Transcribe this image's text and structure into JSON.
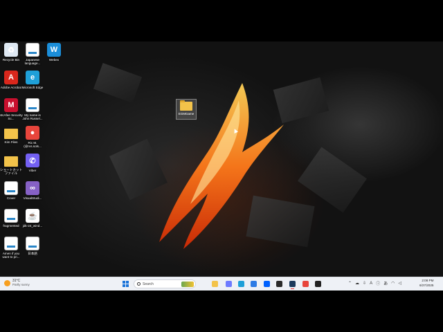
{
  "desktop": {
    "icons": [
      {
        "label": "Recycle Bin",
        "icon": "recycle-bin-icon",
        "color": "#dfe9f3",
        "glyph": "♻"
      },
      {
        "label": "Japanese language...",
        "icon": "document-icon",
        "color": "#ffffff",
        "glyph": ""
      },
      {
        "label": "Webex",
        "icon": "webex-icon",
        "color": "#1b8ed9",
        "glyph": "W"
      },
      {
        "label": "Adobe Acrobat",
        "icon": "acrobat-icon",
        "color": "#d9271c",
        "glyph": "A"
      },
      {
        "label": "Microsoft Edge",
        "icon": "edge-icon",
        "color": "#1fa0d8",
        "glyph": "e"
      },
      {
        "label": "McAfee Security Sc...",
        "icon": "mcafee-icon",
        "color": "#c8102e",
        "glyph": "M"
      },
      {
        "label": "My name is John Russel...",
        "icon": "document-icon",
        "color": "#ffffff",
        "glyph": ""
      },
      {
        "label": "Kim Files",
        "icon": "folder-icon",
        "color": "#f3c34a",
        "glyph": ""
      },
      {
        "label": "Ric M. (@rvs.sols...",
        "icon": "chrome-icon",
        "color": "#e8453c",
        "glyph": "●"
      },
      {
        "label": "ショートカットファイル",
        "icon": "folder-shortcut-icon",
        "color": "#f3c34a",
        "glyph": ""
      },
      {
        "label": "Viber",
        "icon": "viber-icon",
        "color": "#7360f2",
        "glyph": "✆"
      },
      {
        "label": "Cover",
        "icon": "document-icon",
        "color": "#ffffff",
        "glyph": ""
      },
      {
        "label": "VisualStudi...",
        "icon": "visual-studio-icon",
        "color": "#8661c5",
        "glyph": "∞"
      },
      {
        "label": "fragmented",
        "icon": "document-icon",
        "color": "#ffffff",
        "glyph": ""
      },
      {
        "label": "jdk-24_wind...",
        "icon": "java-icon",
        "color": "#ffffff",
        "glyph": "☕"
      },
      {
        "label": "Amen if you want to pri...",
        "icon": "document-icon",
        "color": "#ffffff",
        "glyph": ""
      },
      {
        "label": "日本語",
        "icon": "document-icon",
        "color": "#ffffff",
        "glyph": ""
      }
    ],
    "selected_folder": {
      "label": "EGMGame",
      "icon": "folder-icon"
    }
  },
  "taskbar": {
    "weather": {
      "temp": "31°C",
      "condition": "Partly sunny"
    },
    "search_placeholder": "Search",
    "apps": [
      {
        "name": "file-explorer",
        "color": "#f3c34a"
      },
      {
        "name": "copilot",
        "color": "#6e7bff"
      },
      {
        "name": "edge",
        "color": "#1fa0d8"
      },
      {
        "name": "store",
        "color": "#2d7be5"
      },
      {
        "name": "dropbox",
        "color": "#0061fe"
      },
      {
        "name": "terminal",
        "color": "#2b2b2b"
      },
      {
        "name": "capture",
        "color": "#1c3a5c"
      },
      {
        "name": "chrome",
        "color": "#e8453c"
      },
      {
        "name": "obs",
        "color": "#222222"
      }
    ],
    "tray": {
      "lang": "A",
      "ime": "あ"
    },
    "clock": {
      "time": "2:08 PM",
      "date": "6/27/2025"
    }
  }
}
